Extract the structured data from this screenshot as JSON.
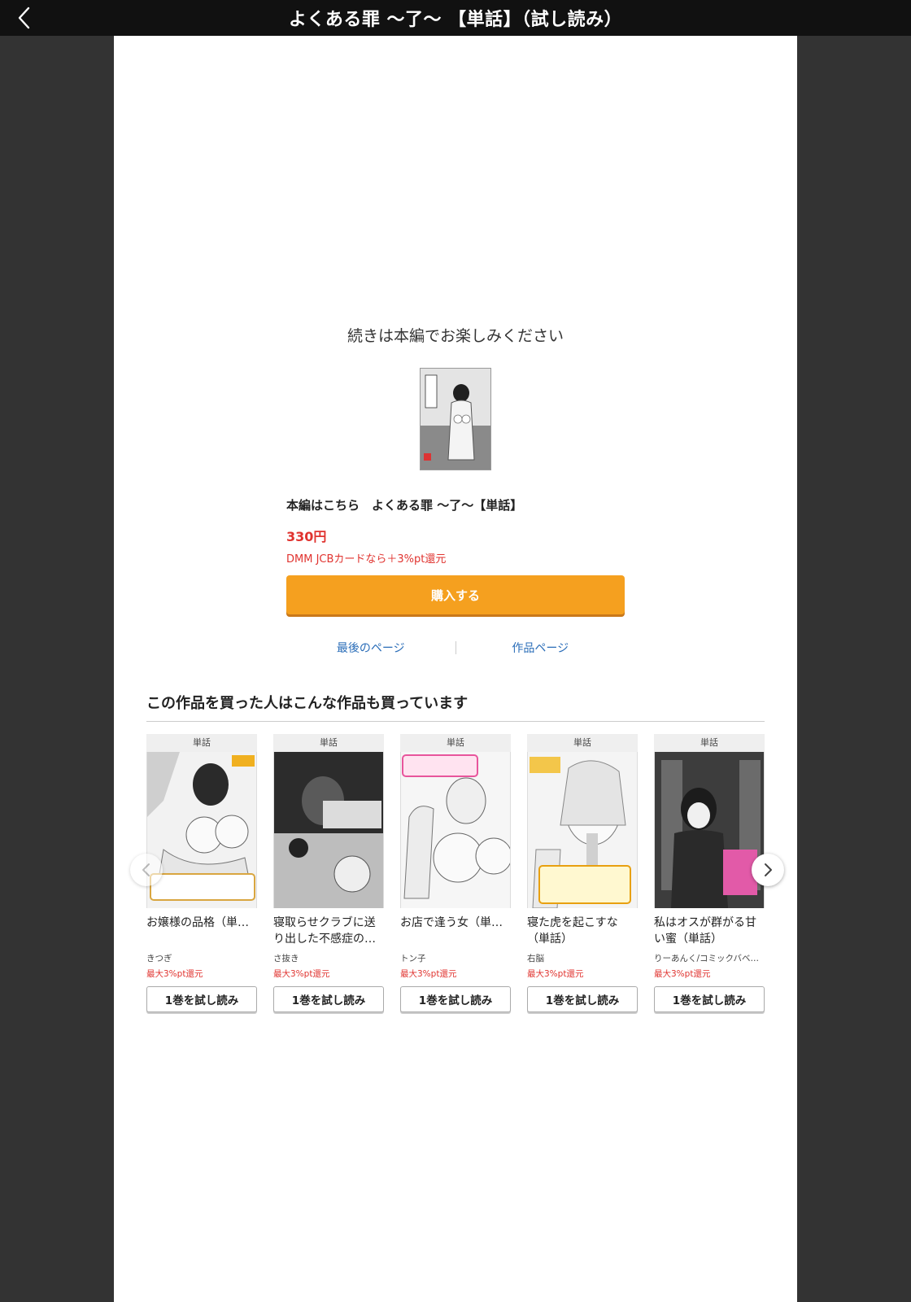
{
  "header": {
    "title": "よくある罪 〜了〜 【単話】（試し読み）",
    "back_icon": "chevron-left-icon"
  },
  "main": {
    "continue_message": "続きは本編でお楽しみください",
    "buy_title": "本編はこちら　よくある罪 〜了〜【単話】",
    "price": "330円",
    "card_note": "DMM JCBカードなら＋3%pt還元",
    "buy_button": "購入する",
    "links": {
      "last_page": "最後のページ",
      "work_page": "作品ページ"
    }
  },
  "recommendations": {
    "title": "この作品を買った人はこんな作品も買っています",
    "items": [
      {
        "badge": "単話",
        "name": "お嬢様の品格（単…",
        "author": "きつぎ",
        "pt": "最大3%pt還元",
        "button": "1巻を試し読み"
      },
      {
        "badge": "単話",
        "name": "寝取らせクラブに送り出した不感症の…",
        "author": "さ抜き",
        "pt": "最大3%pt還元",
        "button": "1巻を試し読み"
      },
      {
        "badge": "単話",
        "name": "お店で逢う女（単…",
        "author": "トン子",
        "pt": "最大3%pt還元",
        "button": "1巻を試し読み"
      },
      {
        "badge": "単話",
        "name": "寝た虎を起こすな（単話）",
        "author": "右脳",
        "pt": "最大3%pt還元",
        "button": "1巻を試し読み"
      },
      {
        "badge": "単話",
        "name": "私はオスが群がる甘い蜜（単話）",
        "author": "りーあんく/コミックバベ…",
        "pt": "最大3%pt還元",
        "button": "1巻を試し読み"
      }
    ]
  },
  "colors": {
    "accent": "#f5a01f",
    "price_red": "#e0332f",
    "link_blue": "#2a6db8",
    "topbar": "#111111",
    "backdrop": "#333333"
  }
}
